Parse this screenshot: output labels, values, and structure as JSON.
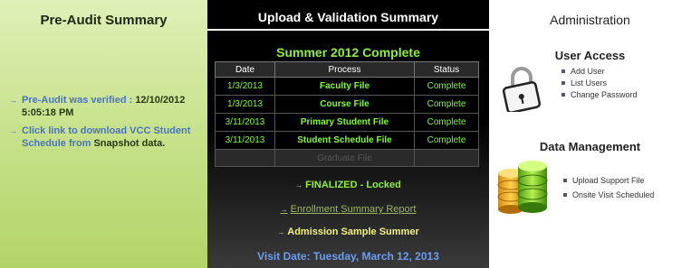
{
  "left": {
    "title": "Pre-Audit Summary",
    "items": [
      {
        "prefix": "Pre-Audit was verified : ",
        "highlight": "12/10/2012 5:05:18 PM"
      },
      {
        "prefix": "Click link to download VCC Student Schedule from ",
        "highlight": "Snapshot data."
      }
    ]
  },
  "center": {
    "title": "Upload & Validation Summary",
    "subtitle": "Summer 2012 Complete",
    "table": {
      "headers": [
        "Date",
        "Process",
        "Status"
      ],
      "rows": [
        [
          "1/3/2013",
          "Faculty File",
          "Complete"
        ],
        [
          "1/3/2013",
          "Course File",
          "Complete"
        ],
        [
          "3/11/2013",
          "Primary Student File",
          "Complete"
        ],
        [
          "3/11/2013",
          "Student Schedule File",
          "Complete"
        ],
        [
          "",
          "Graduate File",
          ""
        ]
      ]
    },
    "links": {
      "finalized": "FINALIZED - Locked",
      "enrollment": "Enrollment Summary Report",
      "admission": "Admission Sample Summer"
    },
    "visit_date": "Visit Date: Tuesday, March 12, 2013"
  },
  "right": {
    "title": "Administration",
    "user_access": {
      "heading": "User Access",
      "items": [
        "Add User",
        "List Users",
        "Change Password"
      ]
    },
    "data_management": {
      "heading": "Data Management",
      "items": [
        "Upload Support File",
        "Onsite Visit Scheduled"
      ]
    }
  },
  "colors": {
    "left_bg": "#c9e38e",
    "accent_green": "#8ef03a",
    "link_blue": "#6a9cf2",
    "table_text": "#7dff2a"
  },
  "icons": [
    "lock-icon",
    "database-icon",
    "arrow-right-icon"
  ]
}
